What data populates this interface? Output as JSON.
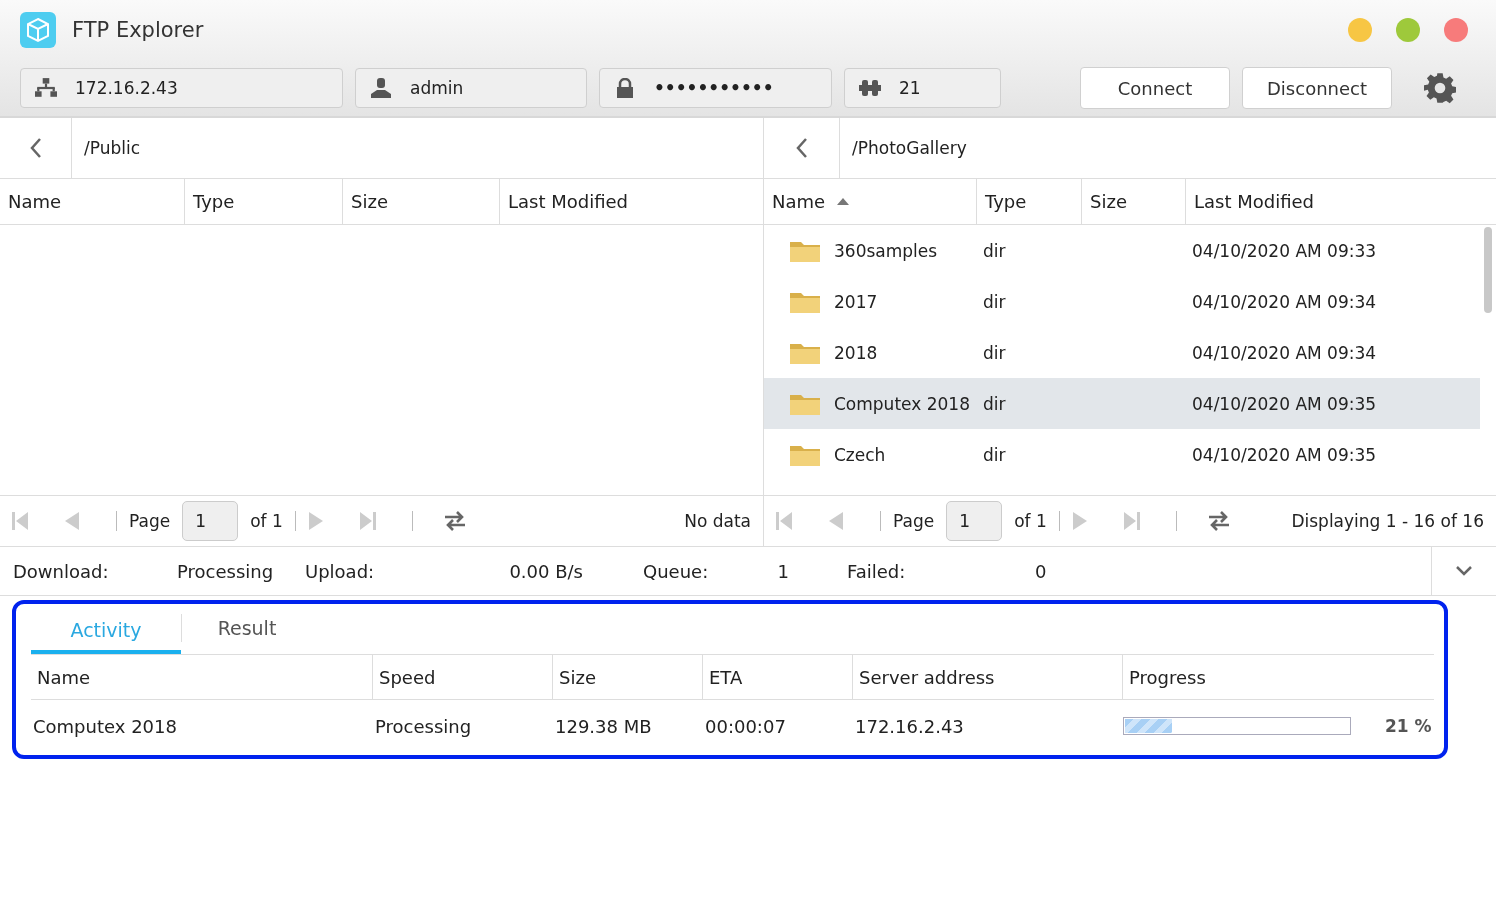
{
  "window": {
    "title": "FTP Explorer"
  },
  "connection": {
    "host": "172.16.2.43",
    "user": "admin",
    "password": "•••••••••••",
    "port": "21",
    "buttons": [
      "Connect",
      "Disconnect"
    ]
  },
  "panes": [
    {
      "path": "/Public",
      "columns": [
        {
          "label": "Name",
          "sorted": false
        },
        {
          "label": "Type",
          "sorted": false
        },
        {
          "label": "Size",
          "sorted": false
        },
        {
          "label": "Last Modified",
          "sorted": false
        }
      ],
      "pager": {
        "page_label": "Page",
        "page": "1",
        "of": "of 1",
        "summary": "No data"
      }
    },
    {
      "path": "/PhotoGallery",
      "columns": [
        {
          "label": "Name",
          "sorted": true
        },
        {
          "label": "Type",
          "sorted": false
        },
        {
          "label": "Size",
          "sorted": false
        },
        {
          "label": "Last Modified",
          "sorted": false
        }
      ],
      "rows": [
        {
          "name": "360samples",
          "type": "dir",
          "modified": "04/10/2020 AM 09:33",
          "selected": false
        },
        {
          "name": "2017",
          "type": "dir",
          "modified": "04/10/2020 AM 09:34",
          "selected": false
        },
        {
          "name": "2018",
          "type": "dir",
          "modified": "04/10/2020 AM 09:34",
          "selected": false
        },
        {
          "name": "Computex 2018",
          "type": "dir",
          "modified": "04/10/2020 AM 09:35",
          "selected": true
        },
        {
          "name": "Czech",
          "type": "dir",
          "modified": "04/10/2020 AM 09:35",
          "selected": false
        }
      ],
      "pager": {
        "page_label": "Page",
        "page": "1",
        "of": "of 1",
        "summary": "Displaying 1 - 16 of 16"
      }
    }
  ],
  "status_bar": [
    {
      "label": "Download:",
      "value": "Processing"
    },
    {
      "label": "Upload:",
      "value": "0.00 B/s"
    },
    {
      "label": "Queue:",
      "value": "1"
    },
    {
      "label": "Failed:",
      "value": "0"
    }
  ],
  "transfers": {
    "tabs": [
      {
        "label": "Activity",
        "selected": true
      },
      {
        "label": "Result",
        "selected": false
      }
    ],
    "columns": [
      "Name",
      "Speed",
      "Size",
      "ETA",
      "Server address",
      "Progress"
    ],
    "rows": [
      {
        "name": "Computex 2018",
        "speed": "Processing",
        "size": "129.38 MB",
        "eta": "00:00:07",
        "server": "172.16.2.43",
        "level": 0.21,
        "percent": "21 %"
      }
    ]
  }
}
